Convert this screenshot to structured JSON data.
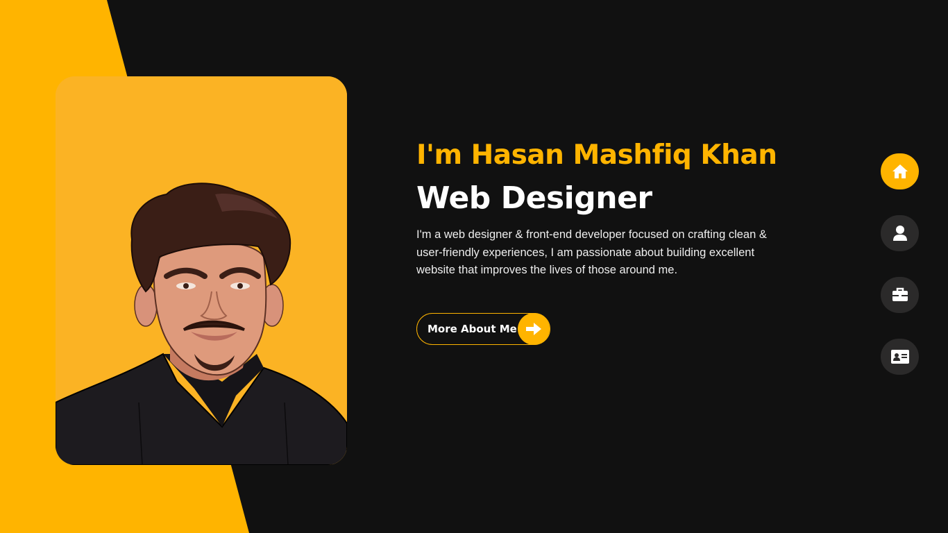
{
  "hero": {
    "name": "I'm Hasan Mashfiq Khan",
    "title": "Web Designer",
    "description": "I'm a web designer & front-end developer focused on crafting clean & user-friendly experiences, I am passionate about building excellent website that improves the lives of those around me."
  },
  "cta": {
    "label": "More About Me",
    "icon": "arrow-right-icon"
  },
  "nav": {
    "items": [
      {
        "icon": "home-icon",
        "active": true
      },
      {
        "icon": "user-icon",
        "active": false
      },
      {
        "icon": "briefcase-icon",
        "active": false
      },
      {
        "icon": "contact-card-icon",
        "active": false
      }
    ]
  },
  "colors": {
    "accent": "#ffb400",
    "background": "#111111",
    "nav_inactive": "#2b2a2a",
    "text": "#ffffff"
  }
}
